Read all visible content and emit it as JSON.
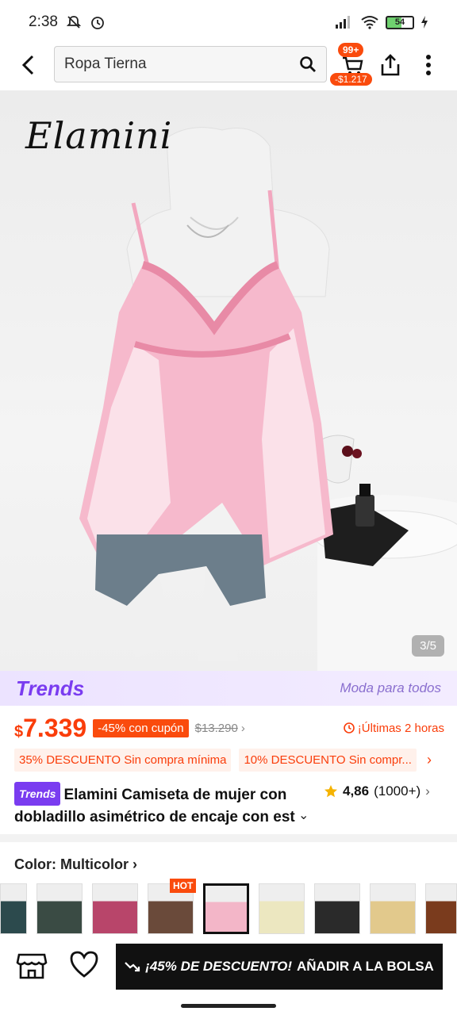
{
  "status_bar": {
    "time": "2:38",
    "battery": "54"
  },
  "header": {
    "search_text": "Ropa Tierna",
    "cart_badge": "99+",
    "cart_price": "-$1.217"
  },
  "image": {
    "brand": "Elamini",
    "counter": "3/5"
  },
  "trends": {
    "logo": "Trends",
    "tagline": "Moda para todos"
  },
  "price": {
    "currency": "$",
    "current": "7.339",
    "discount": "-45% con cupón",
    "original": "$13.290",
    "urgency": "¡Últimas 2 horas"
  },
  "coupons": [
    {
      "label": "35% DESCUENTO Sin compra mínima"
    },
    {
      "label": "10% DESCUENTO Sin compr..."
    }
  ],
  "product": {
    "trends_tag": "Trends",
    "title": "Elamini Camiseta de mujer con dobladillo asimétrico de encaje con est",
    "rating": "4,86",
    "reviews": "(1000+)"
  },
  "color": {
    "label": "Color: Multicolor",
    "hot": "HOT"
  },
  "colors": {
    "accent": "#fa4b0d",
    "price_red": "#fa3d0a",
    "trends_purple": "#7a3cf0"
  },
  "bottom": {
    "promo": "¡45% DE DESCUENTO!",
    "action": "AÑADIR A LA BOLSA"
  }
}
